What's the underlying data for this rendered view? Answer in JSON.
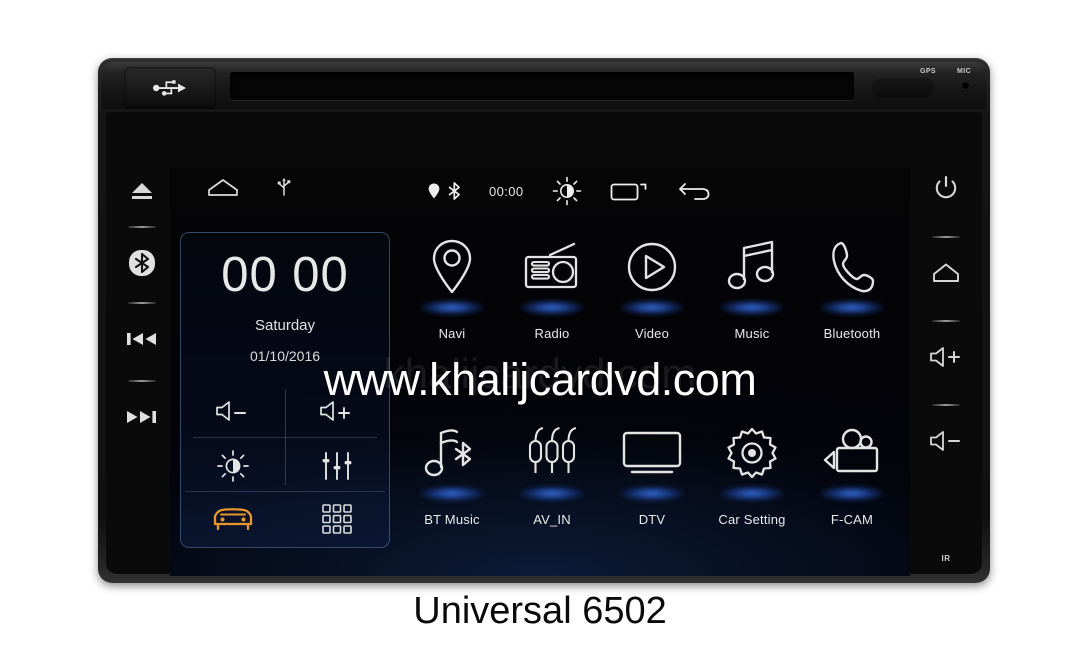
{
  "caption": "Universal 6502",
  "watermark": {
    "main": "www.khalijcardvd.com",
    "faint": "khalijcardvd.com"
  },
  "device": {
    "top_panel": {
      "usb_icon": "usb-icon",
      "cd_slot": "cd-slot",
      "gps_label": "GPS",
      "mic_label": "MIC"
    },
    "left_buttons": [
      {
        "name": "eject-button",
        "icon": "eject-icon"
      },
      {
        "name": "bluetooth-button",
        "icon": "bluetooth-icon"
      },
      {
        "name": "previous-track-button",
        "icon": "previous-track-icon"
      },
      {
        "name": "next-track-button",
        "icon": "next-track-icon"
      }
    ],
    "right_buttons": [
      {
        "name": "power-button",
        "icon": "power-icon"
      },
      {
        "name": "home-button",
        "icon": "home-icon"
      },
      {
        "name": "volume-up-button",
        "icon": "volume-up-icon"
      },
      {
        "name": "volume-down-button",
        "icon": "volume-down-icon"
      }
    ],
    "ir_label": "IR"
  },
  "screen": {
    "statusbar": {
      "home_icon": "home-icon",
      "usb_icon": "usb-icon",
      "location_icon": "location-pin-icon",
      "bluetooth_icon": "bluetooth-icon",
      "time": "00:00",
      "brightness_icon": "brightness-icon",
      "recents_icon": "recent-apps-icon",
      "back_icon": "back-arrow-icon"
    },
    "widget": {
      "clock": "00 00",
      "weekday": "Saturday",
      "date": "01/10/2016",
      "controls": [
        {
          "name": "volume-down-control",
          "icon": "volume-down-icon"
        },
        {
          "name": "volume-up-control",
          "icon": "volume-up-icon"
        },
        {
          "name": "brightness-control",
          "icon": "brightness-icon"
        },
        {
          "name": "equalizer-control",
          "icon": "equalizer-icon"
        }
      ],
      "shortcuts": [
        {
          "name": "car-shortcut",
          "icon": "car-icon",
          "color": "#e8962e"
        },
        {
          "name": "all-apps-shortcut",
          "icon": "apps-grid-icon",
          "color": "#dcdcdc"
        }
      ]
    },
    "apps": {
      "row1": [
        {
          "label": "Navi",
          "icon": "location-pin-icon"
        },
        {
          "label": "Radio",
          "icon": "radio-icon"
        },
        {
          "label": "Video",
          "icon": "play-circle-icon"
        },
        {
          "label": "Music",
          "icon": "music-note-icon"
        },
        {
          "label": "Bluetooth",
          "icon": "phone-handset-icon"
        }
      ],
      "row2": [
        {
          "label": "BT Music",
          "icon": "bluetooth-music-icon"
        },
        {
          "label": "AV_IN",
          "icon": "rca-plugs-icon"
        },
        {
          "label": "DTV",
          "icon": "television-icon"
        },
        {
          "label": "Car Setting",
          "icon": "gear-icon"
        },
        {
          "label": "F-CAM",
          "icon": "video-camera-icon"
        }
      ]
    }
  },
  "colors": {
    "accent_blue": "#3c78eb",
    "orange": "#e8962e",
    "icon_white": "#e4e4e4",
    "page_bg": "#ffffff"
  }
}
